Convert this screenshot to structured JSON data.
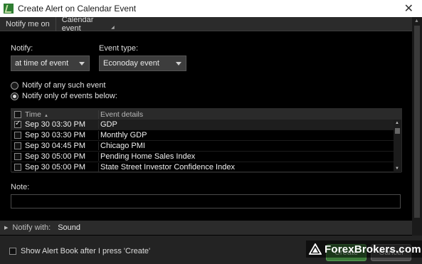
{
  "window": {
    "title": "Create Alert on Calendar Event",
    "close_glyph": "✕"
  },
  "header": {
    "label": "Notify me on",
    "dropdown_value": "Calendar event"
  },
  "notify": {
    "label": "Notify:",
    "value": "at time of event"
  },
  "event_type": {
    "label": "Event type:",
    "value": "Econoday event"
  },
  "radios": [
    {
      "label": "Notify of any such event",
      "selected": false
    },
    {
      "label": "Notify only of events below:",
      "selected": true
    }
  ],
  "table": {
    "columns": [
      "Time",
      "Event details"
    ],
    "rows": [
      {
        "checked": true,
        "time": "Sep 30 03:30 PM",
        "details": "GDP"
      },
      {
        "checked": false,
        "time": "Sep 30 03:30 PM",
        "details": "Monthly GDP"
      },
      {
        "checked": false,
        "time": "Sep 30 04:45 PM",
        "details": "Chicago PMI"
      },
      {
        "checked": false,
        "time": "Sep 30 05:00 PM",
        "details": "Pending Home Sales Index"
      },
      {
        "checked": false,
        "time": "Sep 30 05:00 PM",
        "details": "State Street Investor Confidence Index"
      }
    ]
  },
  "note": {
    "label": "Note:",
    "value": ""
  },
  "notify_with": {
    "label": "Notify with:",
    "value": "Sound"
  },
  "footer": {
    "show_alert_book_label": "Show Alert Book after I press 'Create'",
    "show_alert_book_checked": false,
    "create_label": "Create",
    "cancel_label": "Cancel"
  },
  "watermark": {
    "text": "ForexBrokers.com"
  },
  "colors": {
    "background": "#000000",
    "panel": "#2b2b2b",
    "create_button": "#3d7b3a"
  }
}
